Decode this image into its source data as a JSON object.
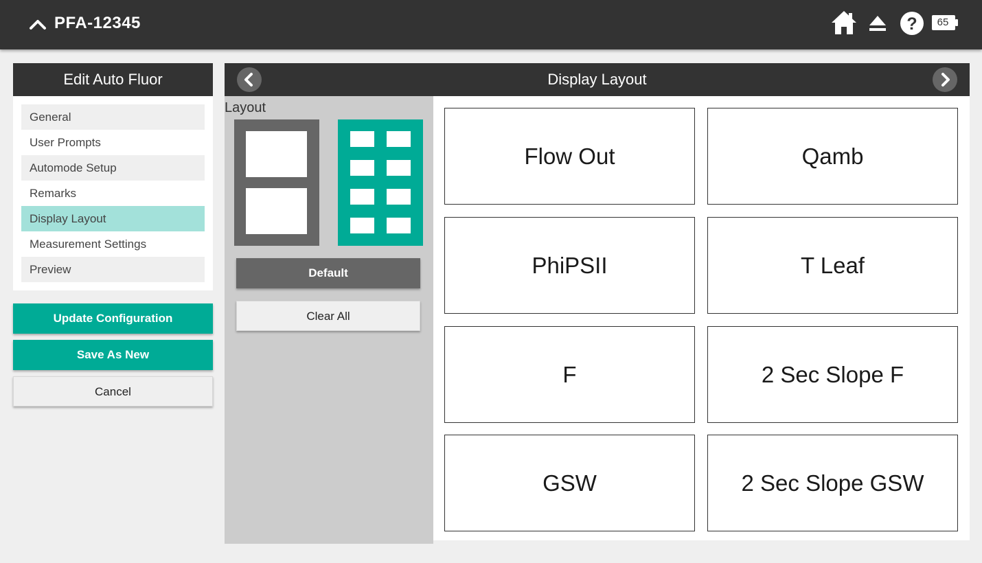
{
  "header": {
    "device_name": "PFA-12345",
    "battery_percent": "65",
    "icons": [
      "chevron-up-icon",
      "home-icon",
      "eject-icon",
      "help-icon",
      "battery-icon"
    ]
  },
  "sidebar": {
    "title": "Edit Auto Fluor",
    "items": [
      {
        "label": "General"
      },
      {
        "label": "User Prompts"
      },
      {
        "label": "Automode Setup"
      },
      {
        "label": "Remarks"
      },
      {
        "label": "Display Layout",
        "active": true
      },
      {
        "label": "Measurement Settings"
      },
      {
        "label": "Preview"
      }
    ]
  },
  "actions": {
    "update_label": "Update Configuration",
    "save_new_label": "Save As New",
    "cancel_label": "Cancel"
  },
  "panel": {
    "title": "Display Layout",
    "layout_label": "Layout",
    "default_label": "Default",
    "clear_label": "Clear All",
    "layout_options": [
      {
        "name": "2-tile layout",
        "selected": false
      },
      {
        "name": "8-tile layout",
        "selected": true
      }
    ]
  },
  "tiles": [
    "Flow Out",
    "Qamb",
    "PhiPSII",
    "T Leaf",
    "F",
    "2 Sec Slope F",
    "GSW",
    "2 Sec Slope GSW"
  ],
  "colors": {
    "dark": "#333333",
    "accent": "#00ab96",
    "active_item": "#a3e1da",
    "gray": "#666666"
  }
}
